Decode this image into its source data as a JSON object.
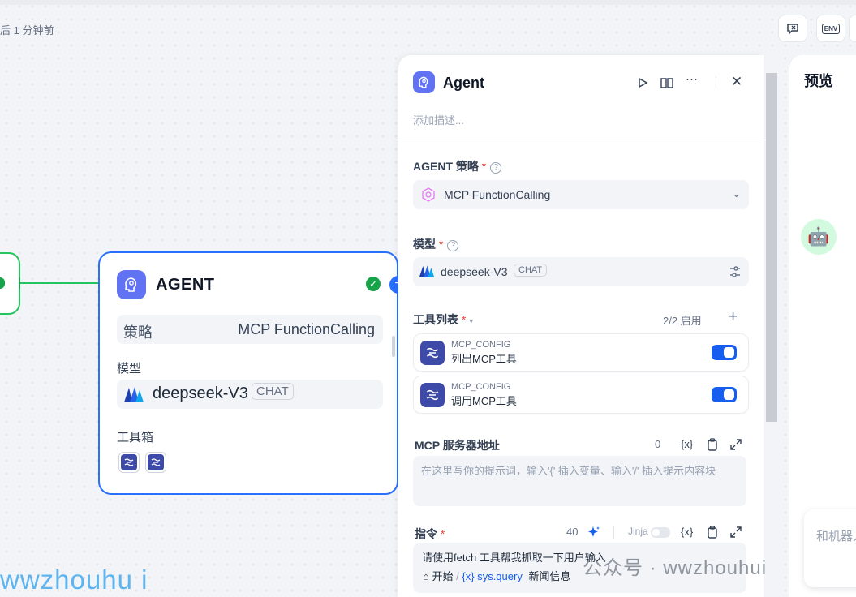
{
  "canvas": {
    "saved_status": "后 1 分钟前",
    "top_buttons": [
      {
        "label": "",
        "icon": "feature-check-icon"
      },
      {
        "label": "ENV",
        "icon": "env-icon"
      }
    ]
  },
  "agent_node": {
    "title": "AGENT",
    "strategy_label": "策略",
    "strategy_value": "MCP FunctionCalling",
    "model_label": "模型",
    "model_name": "deepseek-V3",
    "model_badge": "CHAT",
    "toolbox_label": "工具箱"
  },
  "panel": {
    "title": "Agent",
    "description_placeholder": "添加描述...",
    "strategy": {
      "label": "AGENT 策略",
      "required": "*",
      "value": "MCP FunctionCalling"
    },
    "model": {
      "label": "模型",
      "required": "*",
      "name": "deepseek-V3",
      "badge": "CHAT"
    },
    "tools": {
      "label": "工具列表",
      "required": "*",
      "count": "2/2 启用",
      "items": [
        {
          "provider": "MCP_CONFIG",
          "name": "列出MCP工具",
          "enabled": true
        },
        {
          "provider": "MCP_CONFIG",
          "name": "调用MCP工具",
          "enabled": true
        }
      ]
    },
    "mcp_server": {
      "label": "MCP 服务器地址",
      "count": "0",
      "var_symbol": "{x}",
      "placeholder": "在这里写你的提示词，输入'{' 插入变量、输入'/' 插入提示内容块"
    },
    "instruction": {
      "label": "指令",
      "required": "*",
      "count": "40",
      "jinja_label": "Jinja",
      "var_symbol": "{x}",
      "text_line1": "请使用fetch 工具帮我抓取一下用户输入",
      "start_node": "开始",
      "separator": "/",
      "variable": "sys.query",
      "text_line2_tail": "新闻信息"
    }
  },
  "preview": {
    "title": "预览",
    "input_placeholder": "和机器人聊天"
  },
  "watermarks": {
    "left": "wwzhouhu i",
    "right": "公众号 · wwzhouhui"
  },
  "colors": {
    "accent": "#155eef",
    "node_border": "#2970ff",
    "edge": "#22c55e",
    "agent_icon_bg": "#6172f3",
    "tool_icon_bg": "#3e4aa7"
  }
}
